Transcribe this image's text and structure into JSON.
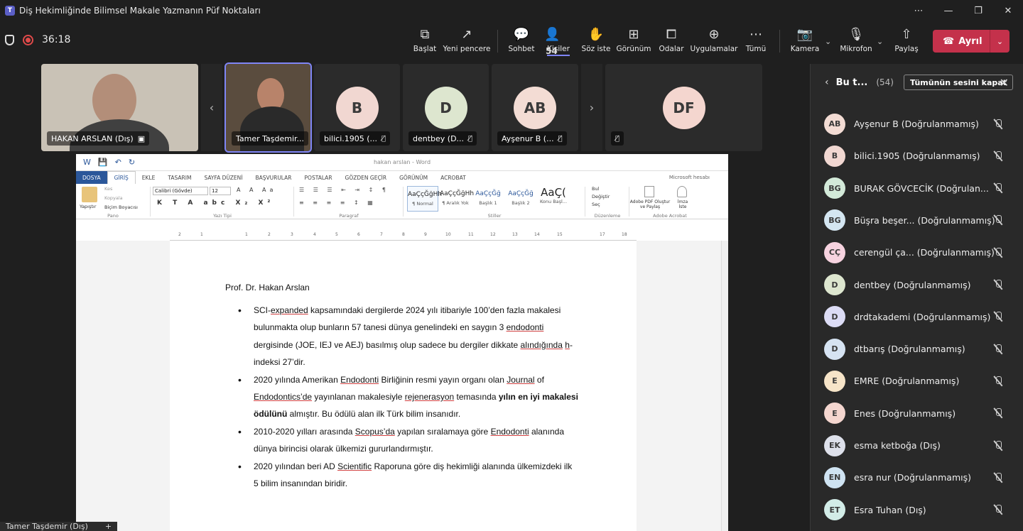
{
  "window": {
    "title": "Diş Hekimliğinde Bilimsel Makale Yazmanın Püf Noktaları"
  },
  "toolbar": {
    "timer": "36:18",
    "buttons": [
      {
        "label": "Başlat",
        "icon": "start-icon"
      },
      {
        "label": "Yeni pencere",
        "icon": "new-window-icon"
      },
      {
        "label": "Sohbet",
        "icon": "chat-icon"
      },
      {
        "label": "Kişiler",
        "icon": "people-icon",
        "count": "54"
      },
      {
        "label": "Söz iste",
        "icon": "raise-hand-icon"
      },
      {
        "label": "Görünüm",
        "icon": "view-icon"
      },
      {
        "label": "Odalar",
        "icon": "rooms-icon"
      },
      {
        "label": "Uygulamalar",
        "icon": "apps-icon"
      },
      {
        "label": "Tümü",
        "icon": "more-icon"
      },
      {
        "label": "Kamera",
        "icon": "camera-off-icon"
      },
      {
        "label": "Mikrofon",
        "icon": "mic-off-icon"
      },
      {
        "label": "Paylaş",
        "icon": "share-icon"
      }
    ],
    "leave_label": "Ayrıl"
  },
  "video_tiles": [
    {
      "name": "HAKAN ARSLAN (Dış)"
    },
    {
      "name": "Tamer Taşdemir..."
    },
    {
      "name": "bilici.1905 (...",
      "initials": "B",
      "color": "#f1d7d1"
    },
    {
      "name": "dentbey (D...",
      "initials": "D",
      "color": "#dde6cf"
    },
    {
      "name": "Ayşenur B (...",
      "initials": "AB",
      "color": "#f3dcd4"
    },
    {
      "initials": "DF",
      "color": "#f4d6cf"
    }
  ],
  "word": {
    "doc_title": "hakan arslan - Word",
    "account": "Microsoft hesabı",
    "tabs": [
      "DOSYA",
      "GİRİŞ",
      "EKLE",
      "TASARIM",
      "SAYFA DÜZENİ",
      "BAŞVURULAR",
      "POSTALAR",
      "GÖZDEN GEÇİR",
      "GÖRÜNÜM",
      "ACROBAT"
    ],
    "ribbon": {
      "paste": "Yapıştır",
      "cut": "Kes",
      "copy": "Kopyala",
      "format_painter": "Biçim Boyacısı",
      "clipboard_group": "Pano",
      "font_name": "Calibri (Gövde)",
      "font_size": "12",
      "font_group": "Yazı Tipi",
      "paragraph_group": "Paragraf",
      "styles": [
        {
          "sample": "AaÇçĞğHh",
          "name": "¶ Normal"
        },
        {
          "sample": "AaÇçĞğHh",
          "name": "¶ Aralık Yok"
        },
        {
          "sample": "AaÇçĞğ",
          "name": "Başlık 1"
        },
        {
          "sample": "AaÇçĞğ",
          "name": "Başlık 2"
        },
        {
          "sample": "AaÇ(",
          "name": "Konu Başl..."
        }
      ],
      "styles_group": "Stiller",
      "find": "Bul",
      "replace": "Değiştir",
      "select": "Seç",
      "editing_group": "Düzenleme",
      "pdf": "Adobe PDF Oluştur ve Paylaş",
      "sign": "İmza İste",
      "acrobat_group": "Adobe Acrobat"
    },
    "ruler": [
      "2",
      "1",
      "1",
      "2",
      "3",
      "4",
      "5",
      "6",
      "7",
      "8",
      "9",
      "10",
      "11",
      "12",
      "13",
      "14",
      "15",
      "17",
      "18"
    ],
    "author": "Prof. Dr. Hakan Arslan",
    "bullets": [
      {
        "segments": [
          {
            "t": "SCI-"
          },
          {
            "t": "expanded",
            "u": true
          },
          {
            "t": " kapsamındaki dergilerde 2024 yılı itibariyle 100’den fazla makalesi bulunmakta olup bunların 57 tanesi dünya genelindeki en saygın 3 "
          },
          {
            "t": "endodonti",
            "u": true
          },
          {
            "t": " dergisinde (JOE, IEJ ve AEJ) basılmış olup sadece bu dergiler dikkate "
          },
          {
            "t": "alındığında",
            "u": true
          },
          {
            "t": " "
          },
          {
            "t": "h",
            "u": true
          },
          {
            "t": "-indeksi 27’dir."
          }
        ]
      },
      {
        "segments": [
          {
            "t": "2020 yılında Amerikan "
          },
          {
            "t": "Endodonti",
            "u": true
          },
          {
            "t": " Birliğinin resmi yayın organı olan "
          },
          {
            "t": "Journal",
            "u": true
          },
          {
            "t": " of "
          },
          {
            "t": "Endodontics’de",
            "u": true
          },
          {
            "t": " yayınlanan makalesiyle "
          },
          {
            "t": "rejenerasyon",
            "u": true
          },
          {
            "t": " temasında "
          },
          {
            "t": "yılın en iyi makalesi ödülünü",
            "b": true
          },
          {
            "t": " almıştır. Bu ödülü alan ilk Türk bilim insanıdır."
          }
        ]
      },
      {
        "segments": [
          {
            "t": "2010-2020 yılları arasında "
          },
          {
            "t": "Scopus’da",
            "u": true
          },
          {
            "t": " yapılan sıralamaya göre "
          },
          {
            "t": "Endodonti",
            "u": true
          },
          {
            "t": " alanında dünya birincisi olarak ülkemizi gururlandırmıştır."
          }
        ]
      },
      {
        "segments": [
          {
            "t": "2020 yılından beri AD "
          },
          {
            "t": "Scientific",
            "u": true
          },
          {
            "t": " Raporuna göre diş hekimliği alanında ülkemizdeki ilk 5 bilim insanından biridir."
          }
        ]
      }
    ]
  },
  "self_label": "Tamer Taşdemir (Dış)",
  "panel": {
    "title": "Bu t...",
    "count": "(54)",
    "mute_all": "Tümünün sesini kapat",
    "participants": [
      {
        "initials": "AB",
        "name": "Ayşenur B (Doğrulanmamış)",
        "color": "#f3dcd4"
      },
      {
        "initials": "B",
        "name": "bilici.1905 (Doğrulanmamış)",
        "color": "#f1d7d1"
      },
      {
        "initials": "BG",
        "name": "BURAK GÖVCECİK (Doğrulan...",
        "color": "#d3ead9"
      },
      {
        "initials": "BG",
        "name": "Büşra beşer... (Doğrulanmamış)",
        "color": "#d4e6f1"
      },
      {
        "initials": "CÇ",
        "name": "cerengül ça... (Doğrulanmamış)",
        "color": "#f7d3e0"
      },
      {
        "initials": "D",
        "name": "dentbey (Doğrulanmamış)",
        "color": "#dde6cf"
      },
      {
        "initials": "D",
        "name": "drdtakademi (Doğrulanmamış)",
        "color": "#dcdcf5"
      },
      {
        "initials": "D",
        "name": "dtbarış (Doğrulanmamış)",
        "color": "#d6e3f2"
      },
      {
        "initials": "E",
        "name": "EMRE (Doğrulanmamış)",
        "color": "#f6e4c8"
      },
      {
        "initials": "E",
        "name": "Enes (Doğrulanmamış)",
        "color": "#f4d6cf"
      },
      {
        "initials": "EK",
        "name": "esma ketboğa (Dış)",
        "color": "#dde0ea"
      },
      {
        "initials": "EN",
        "name": "esra nur (Doğrulanmamış)",
        "color": "#cfe3f2"
      },
      {
        "initials": "ET",
        "name": "Esra Tuhan (Dış)",
        "color": "#d2ece7"
      }
    ]
  }
}
